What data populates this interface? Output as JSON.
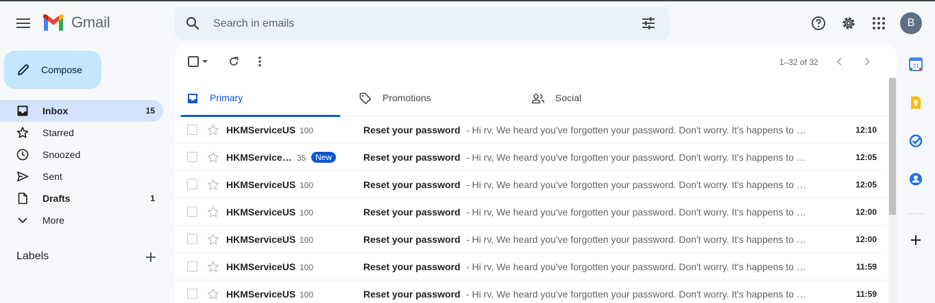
{
  "app": {
    "name": "Gmail"
  },
  "header": {
    "search_placeholder": "Search in emails",
    "avatar_letter": "B"
  },
  "sidebar": {
    "compose_label": "Compose",
    "items": [
      {
        "label": "Inbox",
        "count": "15",
        "icon": "inbox-icon",
        "active": true
      },
      {
        "label": "Starred",
        "count": "",
        "icon": "star-icon"
      },
      {
        "label": "Snoozed",
        "count": "",
        "icon": "clock-icon"
      },
      {
        "label": "Sent",
        "count": "",
        "icon": "send-icon"
      },
      {
        "label": "Drafts",
        "count": "1",
        "icon": "draft-icon"
      },
      {
        "label": "More",
        "count": "",
        "icon": "chevron-down-icon"
      }
    ],
    "labels_heading": "Labels"
  },
  "toolbar": {
    "pagination": "1–32 of 32"
  },
  "tabs": [
    {
      "label": "Primary",
      "icon": "inbox-icon",
      "active": true
    },
    {
      "label": "Promotions",
      "icon": "tag-icon"
    },
    {
      "label": "Social",
      "icon": "people-icon"
    }
  ],
  "emails": [
    {
      "sender": "HKMServiceUS",
      "count": "100",
      "badge": "",
      "subject": "Reset your password",
      "snippet": "- Hi rv, We heard you've forgotten your password. Don't worry. It's happens to everyone.",
      "time": "12:10"
    },
    {
      "sender": "HKMService…",
      "count": "35",
      "badge": "New",
      "subject": "Reset your password",
      "snippet": "- Hi rv, We heard you've forgotten your password. Don't worry. It's happens to everyone.",
      "time": "12:05"
    },
    {
      "sender": "HKMServiceUS",
      "count": "100",
      "badge": "",
      "subject": "Reset your password",
      "snippet": "- Hi rv, We heard you've forgotten your password. Don't worry. It's happens to everyone.",
      "time": "12:05"
    },
    {
      "sender": "HKMServiceUS",
      "count": "100",
      "badge": "",
      "subject": "Reset your password",
      "snippet": "- Hi rv, We heard you've forgotten your password. Don't worry. It's happens to everyone.",
      "time": "12:00"
    },
    {
      "sender": "HKMServiceUS",
      "count": "100",
      "badge": "",
      "subject": "Reset your password",
      "snippet": "- Hi rv, We heard you've forgotten your password. Don't worry. It's happens to everyone.",
      "time": "12:00"
    },
    {
      "sender": "HKMServiceUS",
      "count": "100",
      "badge": "",
      "subject": "Reset your password",
      "snippet": "- Hi rv, We heard you've forgotten your password. Don't worry. It's happens to everyone.",
      "time": "11:59"
    },
    {
      "sender": "HKMServiceUS",
      "count": "100",
      "badge": "",
      "subject": "Reset your password",
      "snippet": "- Hi rv, We heard you've forgotten your password. Don't worry. It's happens to everyone.",
      "time": "11:59"
    }
  ],
  "side_panel": {
    "apps": [
      "calendar-icon",
      "keep-icon",
      "tasks-icon",
      "contacts-icon"
    ],
    "calendar_day": "31"
  },
  "colors": {
    "accent": "#0b57d0",
    "compose_bg": "#c2e7ff",
    "active_nav": "#d3e3fd",
    "search_bg": "#eaf1fb"
  }
}
